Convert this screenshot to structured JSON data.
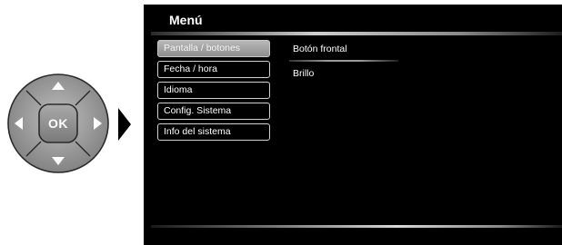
{
  "nav_pad": {
    "center_label": "OK",
    "icons": [
      "arrow-up-icon",
      "arrow-down-icon",
      "arrow-left-icon",
      "arrow-right-icon"
    ]
  },
  "menu": {
    "title": "Menú",
    "items": [
      {
        "label": "Pantalla / botones",
        "selected": true
      },
      {
        "label": "Fecha / hora",
        "selected": false
      },
      {
        "label": "Idioma",
        "selected": false
      },
      {
        "label": "Config. Sistema",
        "selected": false
      },
      {
        "label": "Info del sistema",
        "selected": false
      }
    ]
  },
  "submenu": {
    "items": [
      {
        "label": "Botón frontal"
      },
      {
        "label": "Brillo"
      }
    ]
  },
  "colors": {
    "screen_background": "#000000",
    "text": "#ffffff",
    "selected_item": "#9a9a9a",
    "pad_gray": "#8c8c8c"
  }
}
